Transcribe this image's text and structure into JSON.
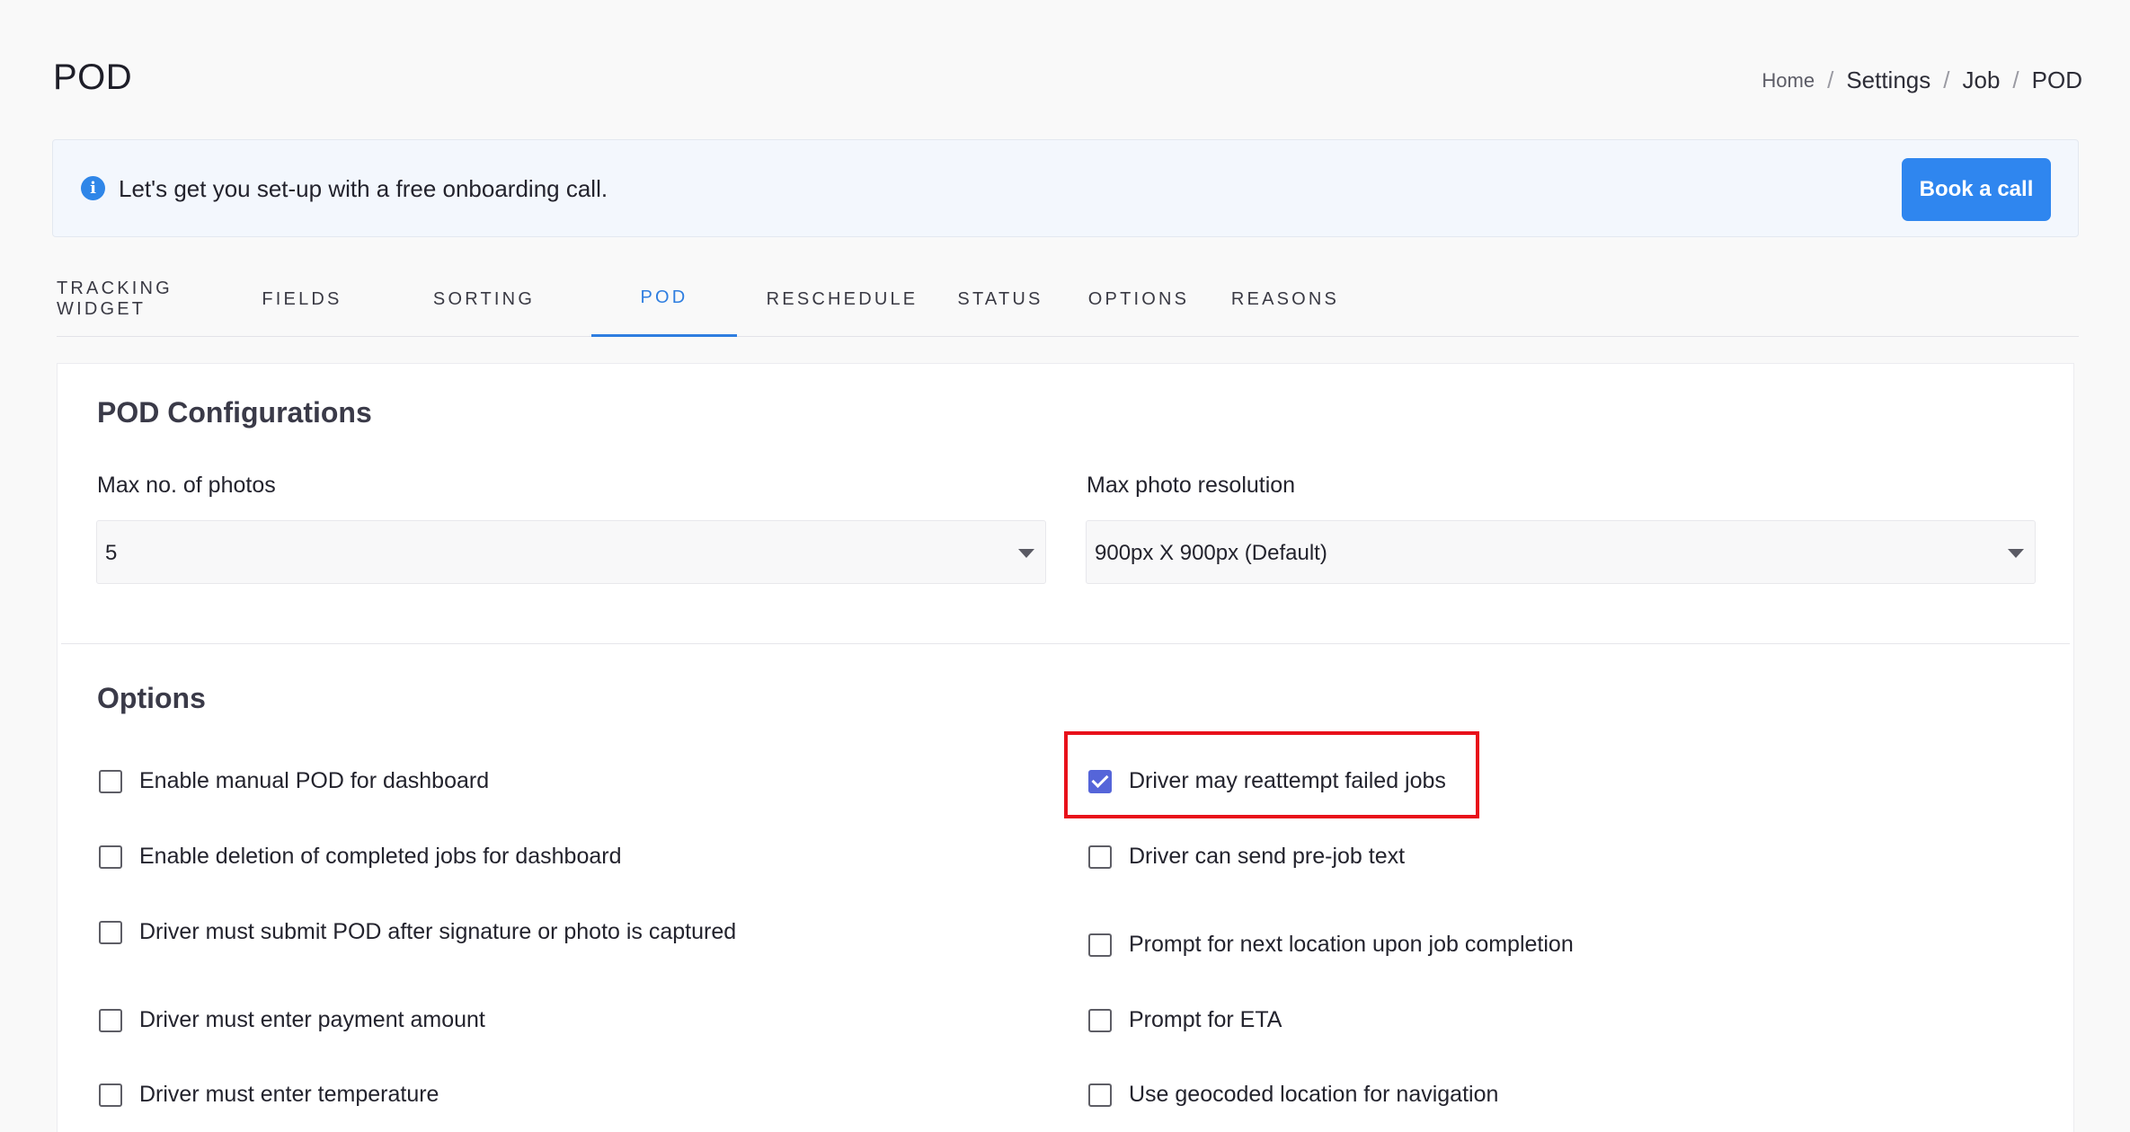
{
  "page": {
    "title": "POD"
  },
  "breadcrumb": {
    "items": [
      "Home",
      "Settings",
      "Job",
      "POD"
    ]
  },
  "banner": {
    "icon": "info-icon",
    "text": "Let's get you set-up with a free onboarding call.",
    "button_label": "Book a call",
    "accent_color": "#2f86ef"
  },
  "tabs": {
    "items": [
      "TRACKING WIDGET",
      "FIELDS",
      "SORTING",
      "POD",
      "RESCHEDULE",
      "STATUS",
      "OPTIONS",
      "REASONS"
    ],
    "active": "POD"
  },
  "pod_config": {
    "title": "POD Configurations",
    "max_photos_label": "Max no. of photos",
    "max_photos_value": "5",
    "max_resolution_label": "Max photo resolution",
    "max_resolution_value": "900px X 900px (Default)"
  },
  "options": {
    "title": "Options",
    "left": [
      {
        "label": "Enable manual POD for dashboard",
        "checked": false
      },
      {
        "label": "Enable deletion of completed jobs for dashboard",
        "checked": false
      },
      {
        "label": "Driver must submit POD after signature or photo is captured",
        "checked": false
      },
      {
        "label": "Driver must enter payment amount",
        "checked": false
      },
      {
        "label": "Driver must enter temperature",
        "checked": false
      }
    ],
    "right": [
      {
        "label": "Driver may reattempt failed jobs",
        "checked": true
      },
      {
        "label": "Driver can send pre-job text",
        "checked": false
      },
      {
        "label": "Prompt for next location upon job completion",
        "checked": false
      },
      {
        "label": "Prompt for ETA",
        "checked": false
      },
      {
        "label": "Use geocoded location for navigation",
        "checked": false
      }
    ],
    "checked_color": "#5565d9",
    "highlight_color": "#e8101a"
  }
}
